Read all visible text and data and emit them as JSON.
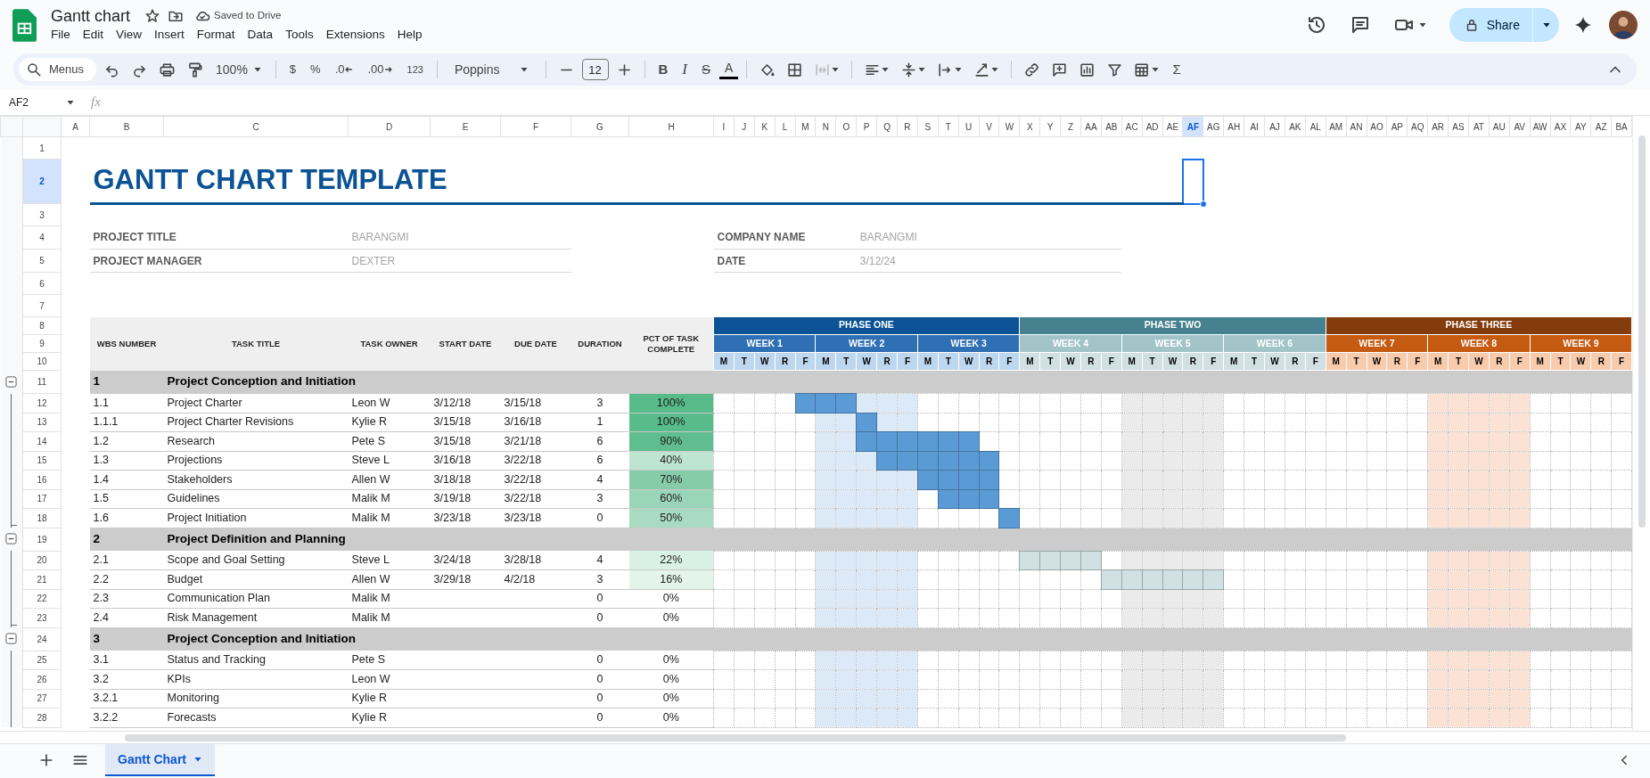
{
  "app": {
    "title": "Gantt chart",
    "save_status": "Saved to Drive",
    "menu": [
      "File",
      "Edit",
      "View",
      "Insert",
      "Format",
      "Data",
      "Tools",
      "Extensions",
      "Help"
    ],
    "share": "Share"
  },
  "toolbar": {
    "search": "Menus",
    "zoom": "100%",
    "currency": "$",
    "percent": "%",
    "decrease_decimal": ".0",
    "increase_decimal": ".00",
    "number_format": "123",
    "font": "Poppins",
    "font_size": "12",
    "bold": "B",
    "italic": "I",
    "strikethrough": "S",
    "text_color": "A",
    "functions": "Σ"
  },
  "formula_bar": {
    "cell_ref": "AF2",
    "fx": "fx"
  },
  "grid": {
    "columns": [
      {
        "label": "A",
        "selected": false
      },
      {
        "label": "B",
        "selected": false
      },
      {
        "label": "C",
        "selected": false
      },
      {
        "label": "D",
        "selected": false
      },
      {
        "label": "E",
        "selected": false
      },
      {
        "label": "F",
        "selected": false
      },
      {
        "label": "G",
        "selected": false
      },
      {
        "label": "H",
        "selected": false
      },
      {
        "label": "I",
        "selected": false
      },
      {
        "label": "J",
        "selected": false
      },
      {
        "label": "K",
        "selected": false
      },
      {
        "label": "L",
        "selected": false
      },
      {
        "label": "M",
        "selected": false
      },
      {
        "label": "N",
        "selected": false
      },
      {
        "label": "O",
        "selected": false
      },
      {
        "label": "P",
        "selected": false
      },
      {
        "label": "Q",
        "selected": false
      },
      {
        "label": "R",
        "selected": false
      },
      {
        "label": "S",
        "selected": false
      },
      {
        "label": "T",
        "selected": false
      },
      {
        "label": "U",
        "selected": false
      },
      {
        "label": "V",
        "selected": false
      },
      {
        "label": "W",
        "selected": false
      },
      {
        "label": "X",
        "selected": false
      },
      {
        "label": "Y",
        "selected": false
      },
      {
        "label": "Z",
        "selected": false
      },
      {
        "label": "AA",
        "selected": false
      },
      {
        "label": "AB",
        "selected": false
      },
      {
        "label": "AC",
        "selected": false
      },
      {
        "label": "AD",
        "selected": false
      },
      {
        "label": "AE",
        "selected": false
      },
      {
        "label": "AF",
        "selected": true
      },
      {
        "label": "AG",
        "selected": false
      },
      {
        "label": "AH",
        "selected": false
      },
      {
        "label": "AI",
        "selected": false
      },
      {
        "label": "AJ",
        "selected": false
      },
      {
        "label": "AK",
        "selected": false
      },
      {
        "label": "AL",
        "selected": false
      },
      {
        "label": "AM",
        "selected": false
      },
      {
        "label": "AN",
        "selected": false
      },
      {
        "label": "AO",
        "selected": false
      },
      {
        "label": "AP",
        "selected": false
      },
      {
        "label": "AQ",
        "selected": false
      },
      {
        "label": "AR",
        "selected": false
      },
      {
        "label": "AS",
        "selected": false
      },
      {
        "label": "AT",
        "selected": false
      },
      {
        "label": "AU",
        "selected": false
      },
      {
        "label": "AV",
        "selected": false
      },
      {
        "label": "AW",
        "selected": false
      },
      {
        "label": "AX",
        "selected": false
      },
      {
        "label": "AY",
        "selected": false
      },
      {
        "label": "AZ",
        "selected": false
      },
      {
        "label": "BA",
        "selected": false
      }
    ],
    "rows": [
      {
        "label": "1",
        "selected": false
      },
      {
        "label": "2",
        "selected": true
      },
      {
        "label": "3",
        "selected": false
      },
      {
        "label": "4",
        "selected": false
      },
      {
        "label": "5",
        "selected": false
      },
      {
        "label": "6",
        "selected": false
      },
      {
        "label": "7",
        "selected": false
      },
      {
        "label": "8",
        "selected": false
      },
      {
        "label": "9",
        "selected": false
      },
      {
        "label": "10",
        "selected": false
      },
      {
        "label": "11",
        "selected": false
      },
      {
        "label": "12",
        "selected": false
      },
      {
        "label": "13",
        "selected": false
      },
      {
        "label": "14",
        "selected": false
      },
      {
        "label": "15",
        "selected": false
      },
      {
        "label": "16",
        "selected": false
      },
      {
        "label": "17",
        "selected": false
      },
      {
        "label": "18",
        "selected": false
      },
      {
        "label": "19",
        "selected": false
      },
      {
        "label": "20",
        "selected": false
      },
      {
        "label": "21",
        "selected": false
      },
      {
        "label": "22",
        "selected": false
      },
      {
        "label": "23",
        "selected": false
      },
      {
        "label": "24",
        "selected": false
      },
      {
        "label": "25",
        "selected": false
      },
      {
        "label": "26",
        "selected": false
      },
      {
        "label": "27",
        "selected": false
      },
      {
        "label": "28",
        "selected": false
      }
    ]
  },
  "sheet": {
    "title": "GANTT CHART TEMPLATE"
  },
  "project_info": {
    "left": [
      {
        "label": "PROJECT TITLE",
        "value": "BARANGMI"
      },
      {
        "label": "PROJECT MANAGER",
        "value": "DEXTER"
      }
    ],
    "right": [
      {
        "label": "COMPANY NAME",
        "value": "BARANGMI"
      },
      {
        "label": "DATE",
        "value": "3/12/24"
      }
    ]
  },
  "table_header": [
    "WBS NUMBER",
    "TASK TITLE",
    "TASK OWNER",
    "START DATE",
    "DUE DATE",
    "DURATION",
    "PCT OF TASK COMPLETE"
  ],
  "phases": [
    {
      "name": "PHASE ONE",
      "color": "#0b5394",
      "weeks": [
        {
          "label": "WEEK 1",
          "color": "#2f6fb4",
          "days": [
            {
              "label": "M",
              "color": "#bdd7ee"
            },
            {
              "label": "T",
              "color": "#bdd7ee"
            },
            {
              "label": "W",
              "color": "#bdd7ee"
            },
            {
              "label": "R",
              "color": "#bdd7ee"
            },
            {
              "label": "F",
              "color": "#bdd7ee"
            }
          ]
        },
        {
          "label": "WEEK 2",
          "color": "#2f6fb4",
          "highlight": {
            "color": "#dce9f7"
          },
          "days": [
            {
              "label": "M",
              "color": "#bdd7ee"
            },
            {
              "label": "T",
              "color": "#bdd7ee"
            },
            {
              "label": "W",
              "color": "#bdd7ee"
            },
            {
              "label": "R",
              "color": "#bdd7ee"
            },
            {
              "label": "F",
              "color": "#bdd7ee"
            }
          ]
        },
        {
          "label": "WEEK 3",
          "color": "#2f6fb4",
          "days": [
            {
              "label": "M",
              "color": "#bdd7ee"
            },
            {
              "label": "T",
              "color": "#bdd7ee"
            },
            {
              "label": "W",
              "color": "#bdd7ee"
            },
            {
              "label": "R",
              "color": "#bdd7ee"
            },
            {
              "label": "F",
              "color": "#bdd7ee"
            }
          ]
        }
      ]
    },
    {
      "name": "PHASE TWO",
      "color": "#45818e",
      "weeks": [
        {
          "label": "WEEK 4",
          "color": "#a2c4c9",
          "days": [
            {
              "label": "M",
              "color": "#d0e0e3"
            },
            {
              "label": "T",
              "color": "#d0e0e3"
            },
            {
              "label": "W",
              "color": "#d0e0e3"
            },
            {
              "label": "R",
              "color": "#d0e0e3"
            },
            {
              "label": "F",
              "color": "#d0e0e3"
            }
          ]
        },
        {
          "label": "WEEK 5",
          "color": "#a2c4c9",
          "highlight": {
            "color": "#ebebeb"
          },
          "days": [
            {
              "label": "M",
              "color": "#d0e0e3"
            },
            {
              "label": "T",
              "color": "#d0e0e3"
            },
            {
              "label": "W",
              "color": "#d0e0e3"
            },
            {
              "label": "R",
              "color": "#d0e0e3"
            },
            {
              "label": "F",
              "color": "#d0e0e3"
            }
          ]
        },
        {
          "label": "WEEK 6",
          "color": "#a2c4c9",
          "days": [
            {
              "label": "M",
              "color": "#d0e0e3"
            },
            {
              "label": "T",
              "color": "#d0e0e3"
            },
            {
              "label": "W",
              "color": "#d0e0e3"
            },
            {
              "label": "R",
              "color": "#d0e0e3"
            },
            {
              "label": "F",
              "color": "#d0e0e3"
            }
          ]
        }
      ]
    },
    {
      "name": "PHASE THREE",
      "color": "#843c0c",
      "weeks": [
        {
          "label": "WEEK 7",
          "color": "#c55a11",
          "days": [
            {
              "label": "M",
              "color": "#f8cbad"
            },
            {
              "label": "T",
              "color": "#f8cbad"
            },
            {
              "label": "W",
              "color": "#f8cbad"
            },
            {
              "label": "R",
              "color": "#f8cbad"
            },
            {
              "label": "F",
              "color": "#f8cbad"
            }
          ]
        },
        {
          "label": "WEEK 8",
          "color": "#c55a11",
          "highlight": {
            "color": "#fbe2d5"
          },
          "days": [
            {
              "label": "M",
              "color": "#f8cbad"
            },
            {
              "label": "T",
              "color": "#f8cbad"
            },
            {
              "label": "W",
              "color": "#f8cbad"
            },
            {
              "label": "R",
              "color": "#f8cbad"
            },
            {
              "label": "F",
              "color": "#f8cbad"
            }
          ]
        },
        {
          "label": "WEEK 9",
          "color": "#c55a11",
          "days": [
            {
              "label": "M",
              "color": "#f8cbad"
            },
            {
              "label": "T",
              "color": "#f8cbad"
            },
            {
              "label": "W",
              "color": "#f8cbad"
            },
            {
              "label": "R",
              "color": "#f8cbad"
            },
            {
              "label": "F",
              "color": "#f8cbad"
            }
          ]
        }
      ]
    }
  ],
  "sections": [
    {
      "wbs": "1",
      "title": "Project Conception and Initiation",
      "expanded": true,
      "tasks": [
        {
          "wbs": "1.1",
          "title": "Project Charter",
          "owner": "Leon W",
          "start": "3/12/18",
          "due": "3/15/18",
          "duration": "3",
          "pct": {
            "text": "100%",
            "color": "#57bb8a"
          },
          "bar": {
            "color": "#5b9bd5",
            "cells": [
              {
                "filled": false
              },
              {
                "filled": false
              },
              {
                "filled": false
              },
              {
                "filled": false
              },
              {
                "filled": true
              },
              {
                "filled": true
              },
              {
                "filled": true
              }
            ]
          }
        },
        {
          "wbs": "1.1.1",
          "title": "Project Charter Revisions",
          "owner": "Kylie R",
          "start": "3/15/18",
          "due": "3/16/18",
          "duration": "1",
          "pct": {
            "text": "100%",
            "color": "#57bb8a"
          },
          "bar": {
            "color": "#5b9bd5",
            "cells": [
              {
                "filled": false
              },
              {
                "filled": false
              },
              {
                "filled": false
              },
              {
                "filled": false
              },
              {
                "filled": false
              },
              {
                "filled": false
              },
              {
                "filled": false
              },
              {
                "filled": true
              }
            ]
          }
        },
        {
          "wbs": "1.2",
          "title": "Research",
          "owner": "Pete S",
          "start": "3/15/18",
          "due": "3/21/18",
          "duration": "6",
          "pct": {
            "text": "90%",
            "color": "#5fbd8f"
          },
          "bar": {
            "color": "#5b9bd5",
            "cells": [
              {
                "filled": false
              },
              {
                "filled": false
              },
              {
                "filled": false
              },
              {
                "filled": false
              },
              {
                "filled": false
              },
              {
                "filled": false
              },
              {
                "filled": false
              },
              {
                "filled": true
              },
              {
                "filled": true
              },
              {
                "filled": true
              },
              {
                "filled": true
              },
              {
                "filled": true
              },
              {
                "filled": true
              }
            ]
          }
        },
        {
          "wbs": "1.3",
          "title": "Projections",
          "owner": "Steve L",
          "start": "3/16/18",
          "due": "3/22/18",
          "duration": "6",
          "pct": {
            "text": "40%",
            "color": "#bde5d1"
          },
          "bar": {
            "color": "#5b9bd5",
            "cells": [
              {
                "filled": false
              },
              {
                "filled": false
              },
              {
                "filled": false
              },
              {
                "filled": false
              },
              {
                "filled": false
              },
              {
                "filled": false
              },
              {
                "filled": false
              },
              {
                "filled": false
              },
              {
                "filled": true
              },
              {
                "filled": true
              },
              {
                "filled": true
              },
              {
                "filled": true
              },
              {
                "filled": true
              },
              {
                "filled": true
              }
            ]
          }
        },
        {
          "wbs": "1.4",
          "title": "Stakeholders",
          "owner": "Allen W",
          "start": "3/18/18",
          "due": "3/22/18",
          "duration": "4",
          "pct": {
            "text": "70%",
            "color": "#86cca9"
          },
          "bar": {
            "color": "#5b9bd5",
            "cells": [
              {
                "filled": false
              },
              {
                "filled": false
              },
              {
                "filled": false
              },
              {
                "filled": false
              },
              {
                "filled": false
              },
              {
                "filled": false
              },
              {
                "filled": false
              },
              {
                "filled": false
              },
              {
                "filled": false
              },
              {
                "filled": false
              },
              {
                "filled": true
              },
              {
                "filled": true
              },
              {
                "filled": true
              },
              {
                "filled": true
              }
            ]
          }
        },
        {
          "wbs": "1.5",
          "title": "Guidelines",
          "owner": "Malik M",
          "start": "3/19/18",
          "due": "3/22/18",
          "duration": "3",
          "pct": {
            "text": "60%",
            "color": "#9ad5b8"
          },
          "bar": {
            "color": "#5b9bd5",
            "cells": [
              {
                "filled": false
              },
              {
                "filled": false
              },
              {
                "filled": false
              },
              {
                "filled": false
              },
              {
                "filled": false
              },
              {
                "filled": false
              },
              {
                "filled": false
              },
              {
                "filled": false
              },
              {
                "filled": false
              },
              {
                "filled": false
              },
              {
                "filled": false
              },
              {
                "filled": true
              },
              {
                "filled": true
              },
              {
                "filled": true
              }
            ]
          }
        },
        {
          "wbs": "1.6",
          "title": "Project Initiation",
          "owner": "Malik M",
          "start": "3/23/18",
          "due": "3/23/18",
          "duration": "0",
          "pct": {
            "text": "50%",
            "color": "#a8dbc1"
          },
          "bar": {
            "color": "#5b9bd5",
            "cells": [
              {
                "filled": false
              },
              {
                "filled": false
              },
              {
                "filled": false
              },
              {
                "filled": false
              },
              {
                "filled": false
              },
              {
                "filled": false
              },
              {
                "filled": false
              },
              {
                "filled": false
              },
              {
                "filled": false
              },
              {
                "filled": false
              },
              {
                "filled": false
              },
              {
                "filled": false
              },
              {
                "filled": false
              },
              {
                "filled": false
              },
              {
                "filled": true
              }
            ]
          }
        }
      ]
    },
    {
      "wbs": "2",
      "title": "Project Definition and Planning",
      "expanded": true,
      "tasks": [
        {
          "wbs": "2.1",
          "title": "Scope and Goal Setting",
          "owner": "Steve L",
          "start": "3/24/18",
          "due": "3/28/18",
          "duration": "4",
          "pct": {
            "text": "22%",
            "color": "#d9f0e4"
          },
          "bar": {
            "color": "#d0e0e3",
            "cells": [
              {
                "filled": false
              },
              {
                "filled": false
              },
              {
                "filled": false
              },
              {
                "filled": false
              },
              {
                "filled": false
              },
              {
                "filled": false
              },
              {
                "filled": false
              },
              {
                "filled": false
              },
              {
                "filled": false
              },
              {
                "filled": false
              },
              {
                "filled": false
              },
              {
                "filled": false
              },
              {
                "filled": false
              },
              {
                "filled": false
              },
              {
                "filled": false
              },
              {
                "filled": true
              },
              {
                "filled": true
              },
              {
                "filled": true
              },
              {
                "filled": true
              }
            ]
          }
        },
        {
          "wbs": "2.2",
          "title": "Budget",
          "owner": "Allen W",
          "start": "3/29/18",
          "due": "4/2/18",
          "duration": "3",
          "pct": {
            "text": "16%",
            "color": "#e3f4eb"
          },
          "bar": {
            "color": "#d0e0e3",
            "cells": [
              {
                "filled": false
              },
              {
                "filled": false
              },
              {
                "filled": false
              },
              {
                "filled": false
              },
              {
                "filled": false
              },
              {
                "filled": false
              },
              {
                "filled": false
              },
              {
                "filled": false
              },
              {
                "filled": false
              },
              {
                "filled": false
              },
              {
                "filled": false
              },
              {
                "filled": false
              },
              {
                "filled": false
              },
              {
                "filled": false
              },
              {
                "filled": false
              },
              {
                "filled": false
              },
              {
                "filled": false
              },
              {
                "filled": false
              },
              {
                "filled": false
              },
              {
                "filled": true
              },
              {
                "filled": true
              },
              {
                "filled": true
              },
              {
                "filled": true
              },
              {
                "filled": true
              },
              {
                "filled": true
              }
            ]
          }
        },
        {
          "wbs": "2.3",
          "title": "Communication Plan",
          "owner": "Malik M",
          "duration": "0",
          "pct": {
            "text": "0%"
          }
        },
        {
          "wbs": "2.4",
          "title": "Risk Management",
          "owner": "Malik M",
          "duration": "0",
          "pct": {
            "text": "0%"
          }
        }
      ]
    },
    {
      "wbs": "3",
      "title": "Project Conception and Initiation",
      "expanded": true,
      "tasks": [
        {
          "wbs": "3.1",
          "title": "Status and Tracking",
          "owner": "Pete S",
          "duration": "0",
          "pct": {
            "text": "0%"
          }
        },
        {
          "wbs": "3.2",
          "title": "KPIs",
          "owner": "Leon W",
          "duration": "0",
          "pct": {
            "text": "0%"
          }
        },
        {
          "wbs": "3.2.1",
          "title": "Monitoring",
          "owner": "Kylie R",
          "duration": "0",
          "pct": {
            "text": "0%"
          }
        },
        {
          "wbs": "3.2.2",
          "title": "Forecasts",
          "owner": "Kylie R",
          "duration": "0",
          "pct": {
            "text": "0%"
          }
        }
      ]
    }
  ],
  "sheets": [
    {
      "name": "Gantt Chart",
      "selected": true
    }
  ]
}
